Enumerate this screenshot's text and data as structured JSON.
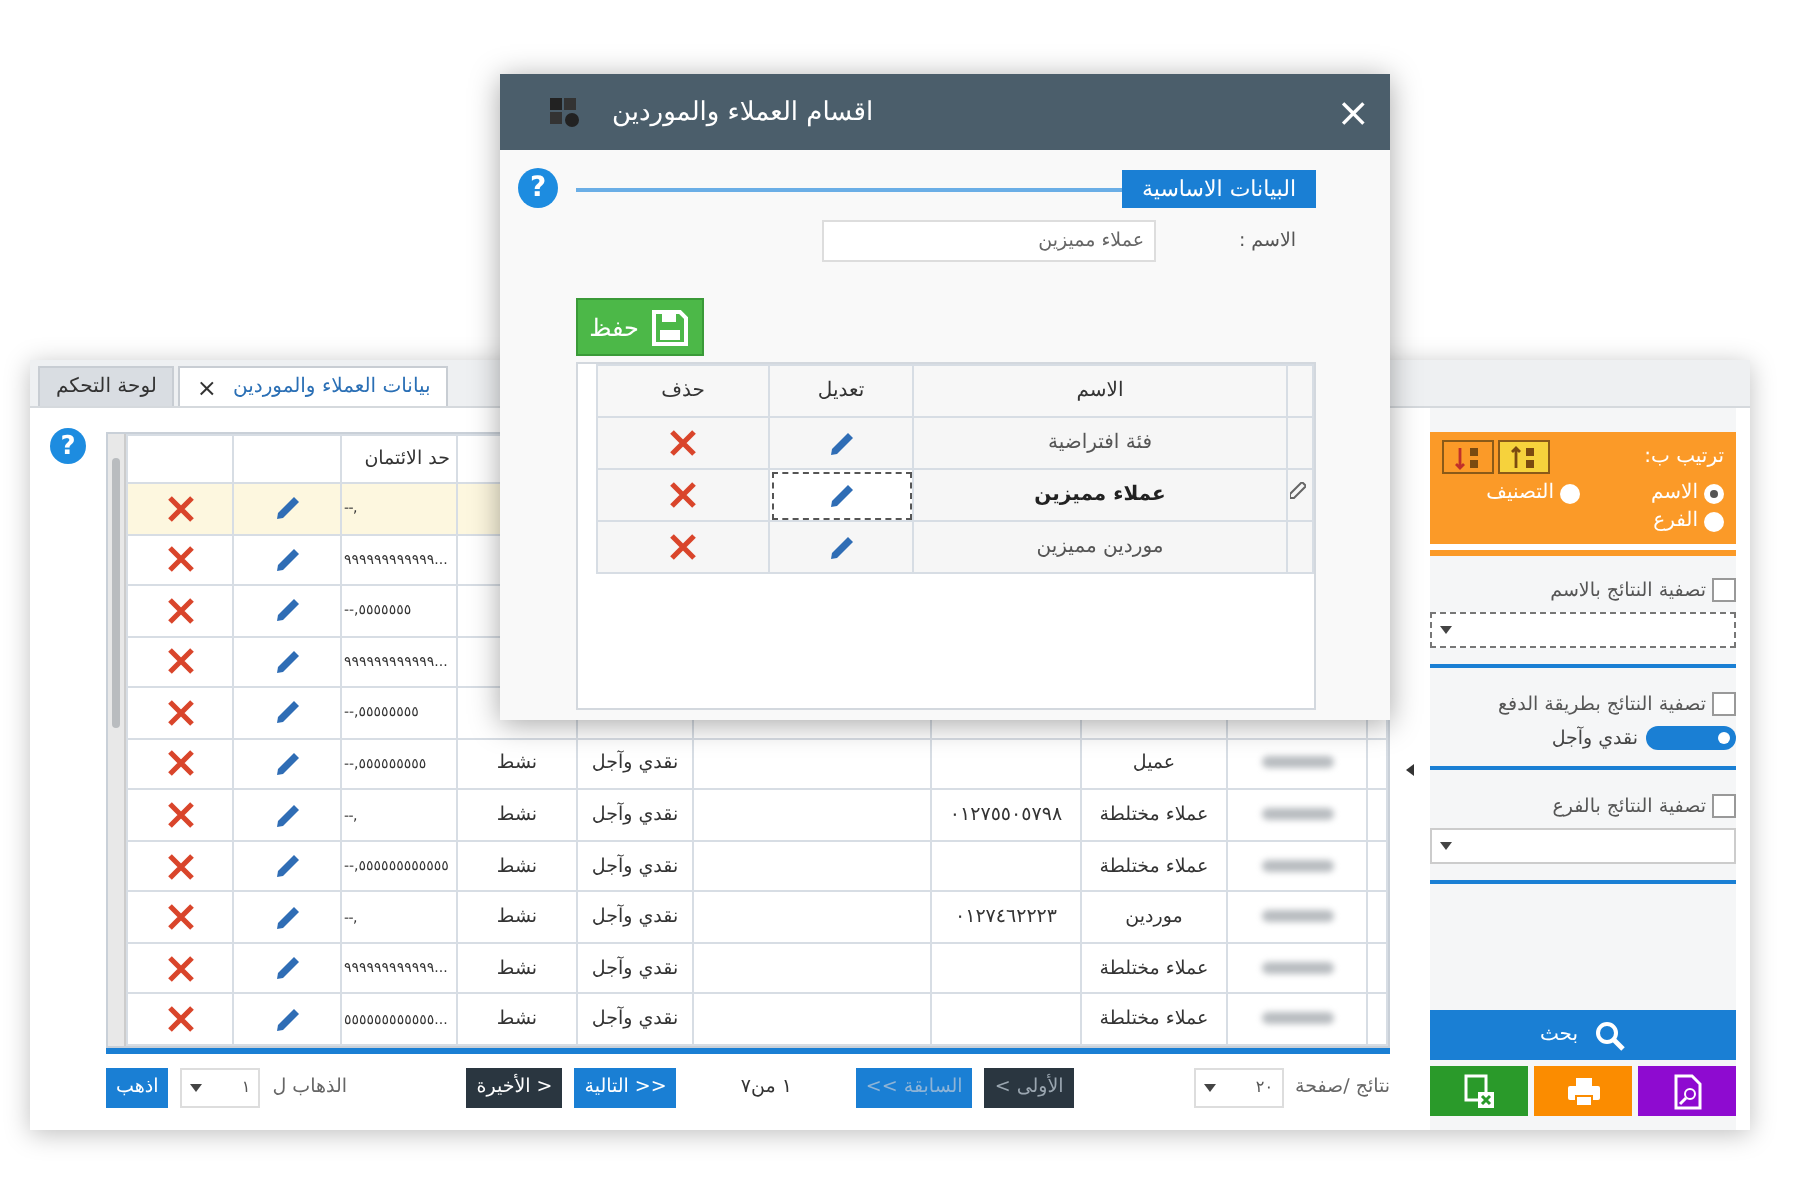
{
  "tabs": [
    {
      "label": "بيانات العملاء والموردين",
      "selected": true,
      "close": "×"
    },
    {
      "label": "لوحة التحكم",
      "selected": false
    }
  ],
  "help": "?",
  "table": {
    "credit_header": "حد الائتمان",
    "rows": [
      {
        "selected": true,
        "credit": ",--"
      },
      {
        "selected": false,
        "credit": "...٩٩٩٩٩٩٩٩٩٩٩٩"
      },
      {
        "selected": false,
        "credit": "٥٥٥٥٥٥٥,--"
      },
      {
        "selected": false,
        "credit": "...٩٩٩٩٩٩٩٩٩٩٩٩"
      },
      {
        "selected": false,
        "credit": "٥٥٥٥٥٥٥٥,--"
      },
      {
        "selected": false,
        "credit": "٥٥٥٥٥٥٥٥٥,--",
        "status": "نشط",
        "payment": "نقدي وآجل",
        "type": "عميل",
        "blurred_name": true
      },
      {
        "selected": false,
        "credit": ",--",
        "status": "نشط",
        "payment": "نقدي وآجل",
        "phone": "٠١٢٧٥٥٠٥٧٩٨",
        "type": "عملاء مختلطة",
        "blurred_name": true
      },
      {
        "selected": false,
        "credit": "٥٥٥٥٥٥٥٥٥٥٥٥,--",
        "status": "نشط",
        "payment": "نقدي وآجل",
        "type": "عملاء مختلطة",
        "blurred_name": true
      },
      {
        "selected": false,
        "credit": ",--",
        "status": "نشط",
        "payment": "نقدي وآجل",
        "phone": "٠١٢٧٤٦٢٢٢٣",
        "type": "موردين",
        "blurred_name": true
      },
      {
        "selected": false,
        "credit": "...٩٩٩٩٩٩٩٩٩٩٩٩",
        "status": "نشط",
        "payment": "نقدي وآجل",
        "type": "عملاء مختلطة",
        "blurred_name": true
      },
      {
        "selected": false,
        "credit": "...٥٥٥٥٥٥٥٥٥٥٥٥",
        "status": "نشط",
        "payment": "نقدي وآجل",
        "type": "عملاء مختلطة",
        "blurred_name": true
      }
    ]
  },
  "pagination": {
    "page_size_label": "نتائج /صفحة",
    "page_size": "٢٠",
    "page_info": "١ من٧",
    "goto_label": "الذهاب ل",
    "goto_value": "١",
    "goto_button": "اذهب",
    "buttons": [
      {
        "label": "< الأولى",
        "kind": "dark",
        "disabled": true
      },
      {
        "label": "<< السابقة",
        "kind": "blue",
        "disabled": true
      },
      {
        "label": "التالية >>",
        "kind": "blue",
        "disabled": false
      },
      {
        "label": "الأخيرة >",
        "kind": "dark",
        "disabled": false
      }
    ]
  },
  "sidebar": {
    "sort_label": "ترتيب ب:",
    "sort_buttons": [
      {
        "selected": false
      },
      {
        "selected": true
      }
    ],
    "sort_options": [
      {
        "label": "الاسم",
        "selected": true
      },
      {
        "label": "التصنيف",
        "selected": false
      },
      {
        "label": "الفرع",
        "selected": false
      }
    ],
    "filters": [
      {
        "kind": "dropdown",
        "label": "تصفية النتائج بالاسم",
        "checked": false,
        "focused": true
      },
      {
        "kind": "toggle",
        "label": "تصفية النتائج بطريقة الدفع",
        "checked": false,
        "toggle_label": "نقدي وآجل",
        "on": true
      },
      {
        "kind": "dropdown",
        "label": "تصفية النتائج بالفرع",
        "checked": false,
        "focused": false
      }
    ],
    "search_button": "بحث"
  },
  "dialog": {
    "title": "اقسام العملاء والموردين",
    "close": "×",
    "help": "?",
    "section_tab": "البيانات الاساسية",
    "name_label": "الاسم :",
    "name_value": "عملاء مميزين",
    "save_button": "حفظ",
    "columns": [
      "الاسم",
      "تعديل",
      "حذف"
    ],
    "rows": [
      {
        "name": "فئة افتراضية",
        "selected": false
      },
      {
        "name": "عملاء مميزين",
        "selected": true
      },
      {
        "name": "موردين مميزين",
        "selected": false
      }
    ]
  }
}
